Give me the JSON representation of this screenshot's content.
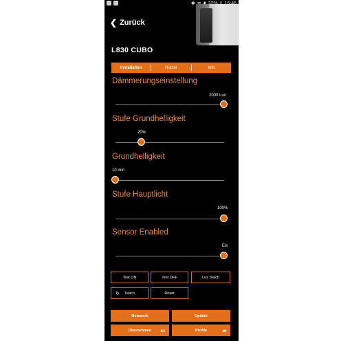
{
  "status": {
    "battery": "32%",
    "time": "16:46"
  },
  "header": {
    "back_label": "Zurück",
    "title": "L830 CUBO"
  },
  "tabs": [
    {
      "label": "Installation",
      "active": true
    },
    {
      "label": "Nutzer",
      "active": false
    },
    {
      "label": "Info",
      "active": false
    }
  ],
  "settings": [
    {
      "title": "Dämmerungseinstellung",
      "value": "2000 Lux",
      "level": 1.0
    },
    {
      "title": "Stufe Grundhelligkeit",
      "value": "20%",
      "level": 0.24
    },
    {
      "title": "Grundhelligkeit",
      "value": "10 min",
      "level": 0.0
    },
    {
      "title": "Stufe Hauptlicht",
      "value": "100%",
      "level": 1.0
    },
    {
      "title": "Sensor Enabled",
      "value": "Ein",
      "level": 1.0
    }
  ],
  "buttons": {
    "test_on": "Test ON",
    "test_off": "Test OFF",
    "lux_teach": "Lux Teach",
    "teach": "Teach",
    "reset": "Reset",
    "netzwerk": "Netzwerk",
    "update": "Update",
    "uebernehmen": "Übernehmen",
    "profile": "Profile"
  },
  "colors": {
    "accent": "#e46f1a",
    "section_title": "#e98a45",
    "background": "#000000"
  }
}
